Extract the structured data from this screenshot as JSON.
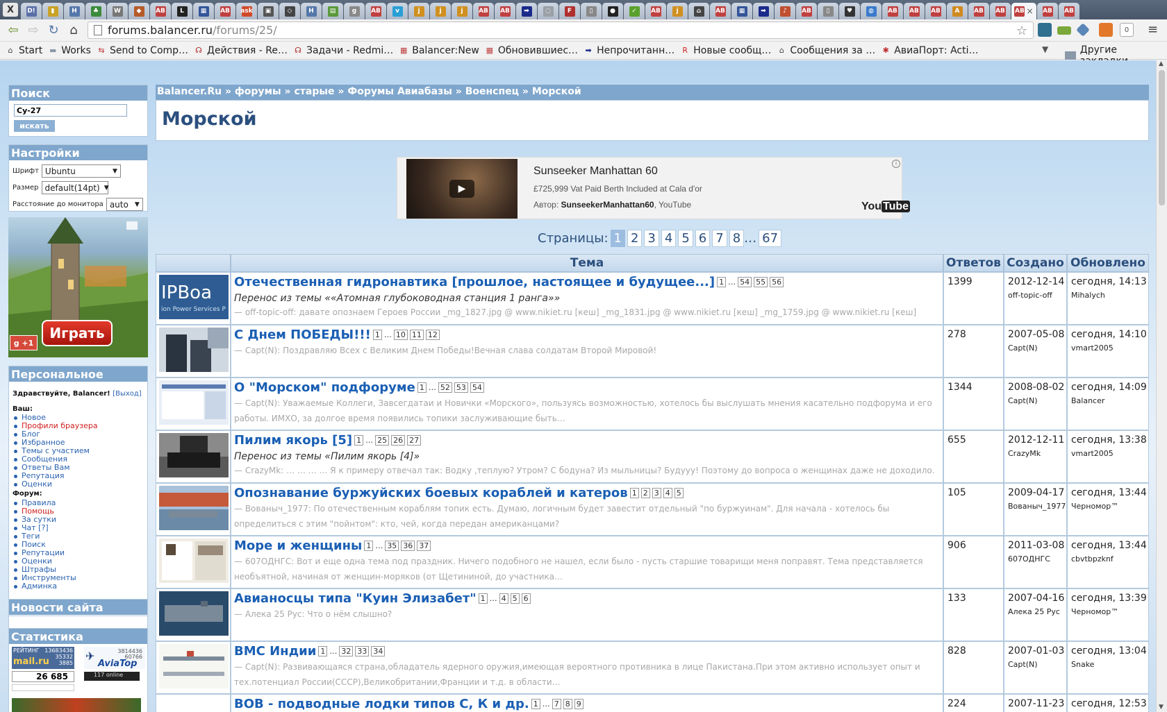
{
  "browser": {
    "window_close": "X",
    "tab_close": "×",
    "tabs": [
      {
        "icon": "dictionary-icon",
        "label": "D!",
        "color": "#5b6fa8"
      },
      {
        "icon": "bookmark-icon",
        "label": "▮",
        "color": "#c9a227"
      },
      {
        "icon": "hn-icon",
        "label": "H",
        "color": "#5577aa"
      },
      {
        "icon": "vine-icon",
        "label": "♣",
        "color": "#3b8b3b"
      },
      {
        "icon": "wordpress-icon",
        "label": "W",
        "color": "#777777"
      },
      {
        "icon": "shield-icon",
        "label": "◆",
        "color": "#b55b2a"
      },
      {
        "icon": "balancer-icon",
        "label": "AB",
        "color": "#c04040"
      },
      {
        "icon": "l-icon",
        "label": "L",
        "color": "#222222"
      },
      {
        "icon": "puzzle-icon",
        "label": "▦",
        "color": "#335599"
      },
      {
        "icon": "balancer-icon",
        "label": "AB",
        "color": "#c04040"
      },
      {
        "icon": "ask-icon",
        "label": "ask",
        "color": "#d04a2a"
      },
      {
        "icon": "game-icon",
        "label": "▣",
        "color": "#555555"
      },
      {
        "icon": "diamond-icon",
        "label": "◇",
        "color": "#444444"
      },
      {
        "icon": "hn-icon",
        "label": "H",
        "color": "#5577aa"
      },
      {
        "icon": "map-icon",
        "label": "▤",
        "color": "#5a9a3a"
      },
      {
        "icon": "gp-icon",
        "label": "g",
        "color": "#888888"
      },
      {
        "icon": "balancer-icon",
        "label": "AB",
        "color": "#c04040"
      },
      {
        "icon": "vimeo-icon",
        "label": "v",
        "color": "#2a9fd6"
      },
      {
        "icon": "j-icon",
        "label": "j",
        "color": "#d09020"
      },
      {
        "icon": "j-icon",
        "label": "j",
        "color": "#d09020"
      },
      {
        "icon": "j-icon",
        "label": "j",
        "color": "#d09020"
      },
      {
        "icon": "balancer-icon",
        "label": "AB",
        "color": "#c04040"
      },
      {
        "icon": "balancer-icon",
        "label": "AB",
        "color": "#c04040"
      },
      {
        "icon": "arrow-icon",
        "label": "➡",
        "color": "#1a2a8a"
      },
      {
        "icon": "blank-icon",
        "label": "◌",
        "color": "#9aa0a8"
      },
      {
        "icon": "fb-icon",
        "label": "F",
        "color": "#b03030"
      },
      {
        "icon": "page-icon",
        "label": "▯",
        "color": "#888888"
      },
      {
        "icon": "github-icon",
        "label": "●",
        "color": "#222222"
      },
      {
        "icon": "check-icon",
        "label": "✓",
        "color": "#5aa02c"
      },
      {
        "icon": "balancer-icon",
        "label": "AB",
        "color": "#c04040"
      },
      {
        "icon": "j-icon",
        "label": "j",
        "color": "#d09020"
      },
      {
        "icon": "home-icon",
        "label": "⌂",
        "color": "#444444"
      },
      {
        "icon": "balancer-icon",
        "label": "AB",
        "color": "#c04040"
      },
      {
        "icon": "puzzle-icon",
        "label": "▦",
        "color": "#335599"
      },
      {
        "icon": "arrow-icon",
        "label": "➡",
        "color": "#1a2a8a"
      },
      {
        "icon": "music-icon",
        "label": "♪",
        "color": "#c05030"
      },
      {
        "icon": "balancer-icon",
        "label": "AB",
        "color": "#c04040"
      },
      {
        "icon": "page-icon",
        "label": "▯",
        "color": "#888888"
      },
      {
        "icon": "heart-icon",
        "label": "♥",
        "color": "#333333"
      },
      {
        "icon": "globe-icon",
        "label": "◍",
        "color": "#3a7acc"
      },
      {
        "icon": "balancer-icon",
        "label": "AB",
        "color": "#c04040"
      },
      {
        "icon": "balancer-icon",
        "label": "AB",
        "color": "#c04040"
      },
      {
        "icon": "balancer-icon",
        "label": "AB",
        "color": "#c04040"
      },
      {
        "icon": "ava-icon",
        "label": "A",
        "color": "#d08a20"
      },
      {
        "icon": "balancer-icon",
        "label": "AB",
        "color": "#c04040"
      },
      {
        "icon": "balancer-icon",
        "label": "AB",
        "color": "#c04040"
      },
      {
        "icon": "balancer-icon",
        "label": "AB",
        "color": "#c04040",
        "active": true
      },
      {
        "icon": "balancer-icon",
        "label": "AB",
        "color": "#c04040"
      },
      {
        "icon": "balancer-icon",
        "label": "AB",
        "color": "#c04040"
      }
    ],
    "back": "⇦",
    "forward": "⇨",
    "reload": "↻",
    "home": "⌂",
    "url_host": "forums.balancer.ru",
    "url_path": "/forums/25/",
    "star": "☆",
    "menu": "≡",
    "ext_badge": "0",
    "bookmarks": [
      {
        "icon": "home-icon",
        "glyph": "⌂",
        "color": "#444444",
        "label": "Start"
      },
      {
        "icon": "folder-icon",
        "glyph": "▬",
        "color": "#8a98a8",
        "label": "Works"
      },
      {
        "icon": "send-icon",
        "glyph": "⇆",
        "color": "#c03030",
        "label": "Send to Comp…"
      },
      {
        "icon": "redmine-icon",
        "glyph": "☊",
        "color": "#b02020",
        "label": "Действия - Re…"
      },
      {
        "icon": "redmine-icon",
        "glyph": "☊",
        "color": "#b02020",
        "label": "Задачи - Redmi…"
      },
      {
        "icon": "balancer-icon",
        "glyph": "▦",
        "color": "#c04040",
        "label": "Balancer:New"
      },
      {
        "icon": "balancer-icon",
        "glyph": "▦",
        "color": "#c04040",
        "label": "Обновившиес…"
      },
      {
        "icon": "arrow-icon",
        "glyph": "➡",
        "color": "#1a2a8a",
        "label": "Непрочитанн…"
      },
      {
        "icon": "r-icon",
        "glyph": "R",
        "color": "#d02020",
        "label": "Новые сообщ…"
      },
      {
        "icon": "home-icon",
        "glyph": "⌂",
        "color": "#444444",
        "label": "Сообщения за …"
      },
      {
        "icon": "aviaport-icon",
        "glyph": "✱",
        "color": "#c03030",
        "label": "АвиаПорт: Acti…"
      }
    ],
    "bookmarks_more": "▼",
    "bookmarks_other": "Другие закладки"
  },
  "sidebar": {
    "search_title": "Поиск",
    "search_value": "Су-27",
    "search_button": "искать",
    "settings_title": "Настройки",
    "font_label": "Шрифт",
    "font_value": "Ubuntu",
    "size_label": "Размер",
    "size_value": "default(14pt)",
    "distance_label": "Расстояние до монитора",
    "distance_value": "auto",
    "ad_play": "Играть",
    "ad_gplus": "g  +1",
    "personal_title": "Персональное",
    "greeting": "Здравствуйте, Balancer!",
    "logout": "[Выход]",
    "yours_label": "Ваш:",
    "yours_items": [
      {
        "label": "Новое",
        "red": false
      },
      {
        "label": "Профили браузера",
        "red": true
      },
      {
        "label": "Блог",
        "red": false
      },
      {
        "label": "Избранное",
        "red": false
      },
      {
        "label": "Темы с участием",
        "red": false
      },
      {
        "label": "Сообщения",
        "red": false
      },
      {
        "label": "Ответы Вам",
        "red": false
      },
      {
        "label": "Репутация",
        "red": false
      },
      {
        "label": "Оценки",
        "red": false
      }
    ],
    "forum_label": "Форум:",
    "forum_items": [
      {
        "label": "Правила",
        "red": false
      },
      {
        "label": "Помощь",
        "red": true
      },
      {
        "label": "За сутки",
        "red": false
      },
      {
        "label": "Чат [?]",
        "red": false
      },
      {
        "label": "Теги",
        "red": false
      },
      {
        "label": "Поиск",
        "red": false
      },
      {
        "label": "Репутации",
        "red": false
      },
      {
        "label": "Оценки",
        "red": false
      },
      {
        "label": "Штрафы",
        "red": false
      },
      {
        "label": "Инструменты",
        "red": false
      },
      {
        "label": "Админка",
        "red": false
      }
    ],
    "news_title": "Новости сайта",
    "stats_title": "Статистика",
    "counter_mail": "mail.ru",
    "counter_mail_label": "РЕЙТИНГ",
    "counter_mail_values": [
      "13683436",
      "35332",
      "3885"
    ],
    "counter_hits": "26 685",
    "counter_avia": "AviaTop",
    "counter_avia_values": [
      "3814436",
      "60766"
    ],
    "counter_online": "117 online"
  },
  "main": {
    "breadcrumb": [
      "Balancer.Ru",
      "форумы",
      "старые",
      "Форумы Авиабазы",
      "Военспец",
      "Морской"
    ],
    "breadcrumb_sep": " » ",
    "title": "Морской",
    "video": {
      "title": "Sunseeker Manhattan 60",
      "subtitle": "£725,999 Vat Paid Berth Included at Cala d'or",
      "author_label": "Автор: ",
      "author": "SunseekerManhattan60",
      "source": ", YouTube",
      "logo_you": "You",
      "logo_tube": "Tube",
      "info": "i"
    },
    "pages_label": "Страницы:",
    "pages": [
      "1",
      "2",
      "3",
      "4",
      "5",
      "6",
      "7",
      "8"
    ],
    "pages_dots": "…",
    "pages_last": "67",
    "headers": {
      "topic": "Тема",
      "replies": "Ответов",
      "created": "Создано",
      "updated": "Обновлено"
    },
    "topics": [
      {
        "thumb": "ipboard",
        "thumb_text": "IPBoa",
        "thumb_sub": "ion Power Services P",
        "title": "Отечественная гидронавтика [прошлое, настоящее и будущее...]",
        "pages": [
          "1",
          "…",
          "54",
          "55",
          "56"
        ],
        "moved": "Перенос из темы ««Атомная глубоководная станция 1 ранга»»",
        "excerpt": "— off-topic-off: давате опознаем Героев России _mg_1827.jpg @ www.nikiet.ru [кеш] _mg_1831.jpg @ www.nikiet.ru [кеш] _mg_1759.jpg @ www.nikiet.ru [кеш]",
        "replies": "1399",
        "created": "2012-12-14",
        "creator": "off-topic-off",
        "updated": "сегодня, 14:13",
        "updater": "Mihalych"
      },
      {
        "thumb": "soldiers",
        "title": "С Днем ПОБЕДЫ!!!",
        "pages": [
          "1",
          "…",
          "10",
          "11",
          "12"
        ],
        "moved": "",
        "excerpt": "— Capt(N): Поздравляю Всех с Великим Днем Победы!Вечная слава солдатам Второй Мировой!",
        "replies": "278",
        "created": "2007-05-08",
        "creator": "Capt(N)",
        "updated": "сегодня, 14:10",
        "updater": "vmart2005"
      },
      {
        "thumb": "screenshot",
        "title": "О \"Морском\" подфоруме",
        "pages": [
          "1",
          "…",
          "52",
          "53",
          "54"
        ],
        "moved": "",
        "excerpt": "— Capt(N): Уважаемые Коллеги, Завсегдатаи и Новички «Морского», пользуясь возможностью, хотелось бы выслушать мнения касательно подфорума и его работы. ИМХО, за долгое время появились топики заслуживающие быть…",
        "replies": "1344",
        "created": "2008-08-02",
        "creator": "Capt(N)",
        "updated": "сегодня, 14:09",
        "updater": "Balancer"
      },
      {
        "thumb": "car",
        "title": "Пилим якорь [5]",
        "pages": [
          "1",
          "…",
          "25",
          "26",
          "27"
        ],
        "moved": "Перенос из темы «Пилим якорь [4]»",
        "excerpt": "— CrazyMk: … … … … Я к примеру отвечал так: Водку ,теплую? Утром? С бодуна? Из мыльницы? Будууу! Поэтому до вопроса о женщинах даже не доходило.",
        "replies": "655",
        "created": "2012-12-11",
        "creator": "CrazyMk",
        "updated": "сегодня, 13:38",
        "updater": "vmart2005"
      },
      {
        "thumb": "harbor",
        "title": "Опознавание буржуйских боевых кораблей и катеров",
        "pages": [
          "1",
          "2",
          "3",
          "4",
          "5"
        ],
        "moved": "",
        "excerpt": "— Вованыч_1977: По отечественным кораблям топик есть. Думаю, логичным будет завестит отдельный \"по буржуинам\". Для начала - хотелось бы определиться с этим \"пойнтом\": кто, чей, когда передан американцами?",
        "replies": "105",
        "created": "2009-04-17",
        "creator": "Вованыч_1977",
        "updated": "сегодня, 13:44",
        "updater": "Черномор™"
      },
      {
        "thumb": "magazine",
        "title": "Море и женщины",
        "pages": [
          "1",
          "…",
          "35",
          "36",
          "37"
        ],
        "moved": "",
        "excerpt": "— 607ОДНГС: Вот и еще одна тема под праздник. Ничего подобного не нашел, если было - пусть старшие товарищи меня поправят. Тема представляется необъятной, начиная от женщин-моряков (от Щетининой, до участника…",
        "replies": "906",
        "created": "2011-03-08",
        "creator": "607ОДНГС",
        "updated": "сегодня, 13:44",
        "updater": "cbvtbpzknf"
      },
      {
        "thumb": "carrier",
        "title": "Авианосцы типа \"Куин Элизабет\"",
        "pages": [
          "1",
          "…",
          "4",
          "5",
          "6"
        ],
        "moved": "",
        "excerpt": "— Алека 25 Рус: Что о нём слышно?",
        "replies": "133",
        "created": "2007-04-16",
        "creator": "Алека 25 Рус",
        "updated": "сегодня, 13:39",
        "updater": "Черномор™"
      },
      {
        "thumb": "drawing",
        "title": "ВМС Индии",
        "pages": [
          "1",
          "…",
          "32",
          "33",
          "34"
        ],
        "moved": "",
        "excerpt": "— Capt(N): Развивающаяся страна,обладатель ядерного оружия,имеющая вероятного противника в лице Пакистана.При этом активно использует опыт и тех.потенциал России(СССР),Великобритании,Франции и т.д. в области…",
        "replies": "828",
        "created": "2007-01-03",
        "creator": "Capt(N)",
        "updated": "сегодня, 13:04",
        "updater": "Snake"
      },
      {
        "thumb": "plain",
        "title": "ВОВ - подводные лодки типов С, К и др.",
        "pages": [
          "1",
          "…",
          "7",
          "8",
          "9"
        ],
        "moved": "",
        "excerpt": "",
        "replies": "224",
        "created": "2007-11-23",
        "creator": "",
        "updated": "сегодня, 12:53",
        "updater": ""
      }
    ]
  }
}
